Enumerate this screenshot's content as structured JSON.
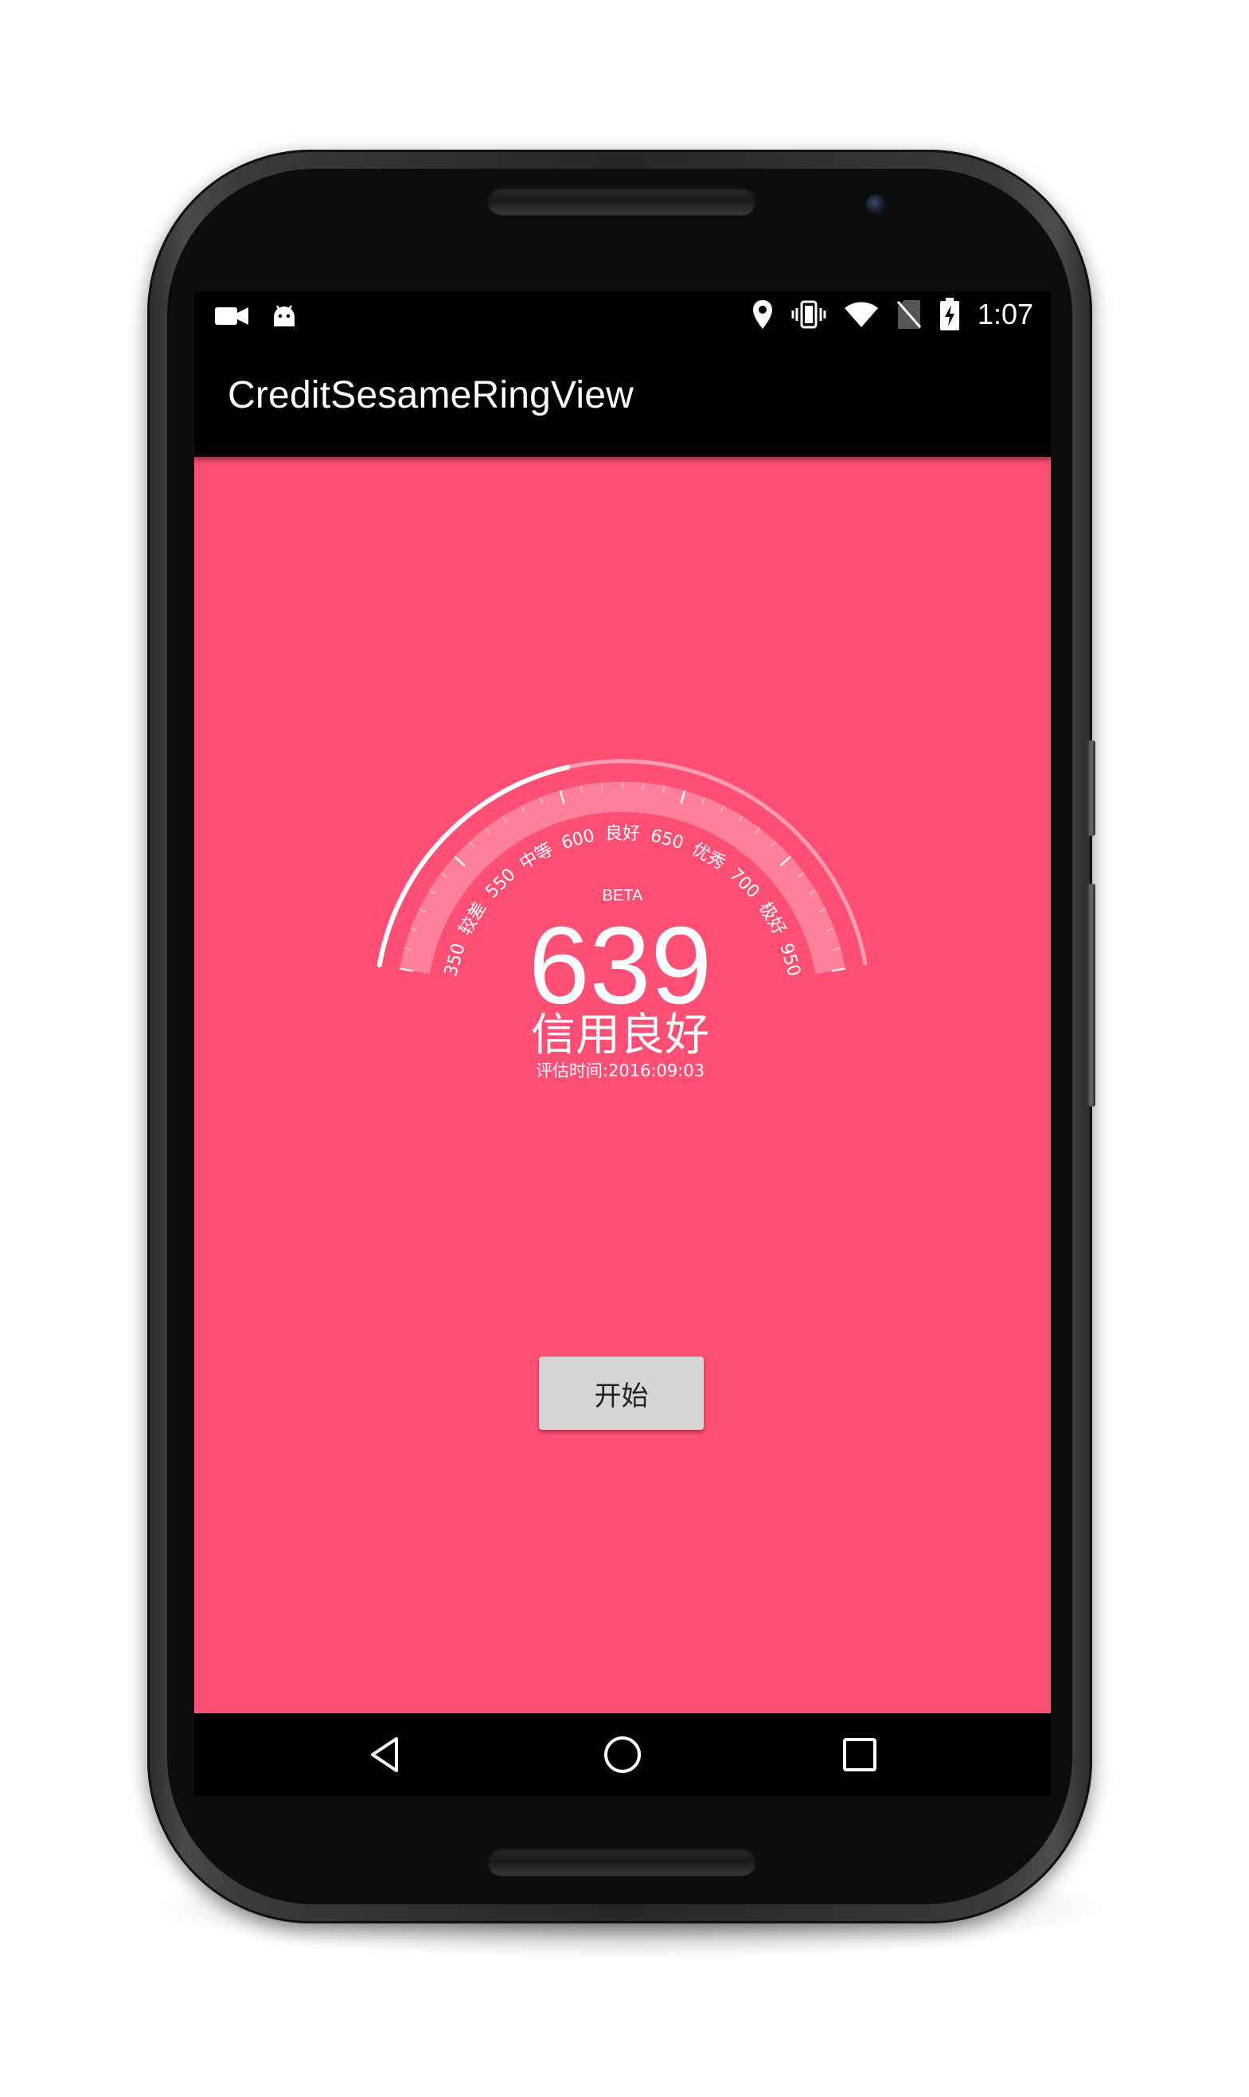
{
  "status_bar": {
    "time": "1:07",
    "left_icons": [
      "video-camera-icon",
      "android-icon"
    ],
    "right_icons": [
      "location-pin-icon",
      "vibrate-icon",
      "wifi-icon",
      "no-sim-icon",
      "battery-charging-icon"
    ]
  },
  "app_bar": {
    "title": "CreditSesameRingView"
  },
  "gauge": {
    "beta_label": "BETA",
    "score": "639",
    "rating": "信用良好",
    "eval_time": "评估时间:2016:09:03",
    "scale_labels": [
      "350",
      "较差",
      "550",
      "中等",
      "600",
      "良好",
      "650",
      "优秀",
      "700",
      "极好",
      "950"
    ],
    "progress_fraction": 0.42
  },
  "actions": {
    "start_label": "开始"
  },
  "nav_bar": {
    "buttons": [
      "back-icon",
      "home-icon",
      "recents-icon"
    ]
  },
  "colors": {
    "background": "#ff4f75",
    "ring": "#ffffff",
    "button": "#d6d6d6"
  }
}
